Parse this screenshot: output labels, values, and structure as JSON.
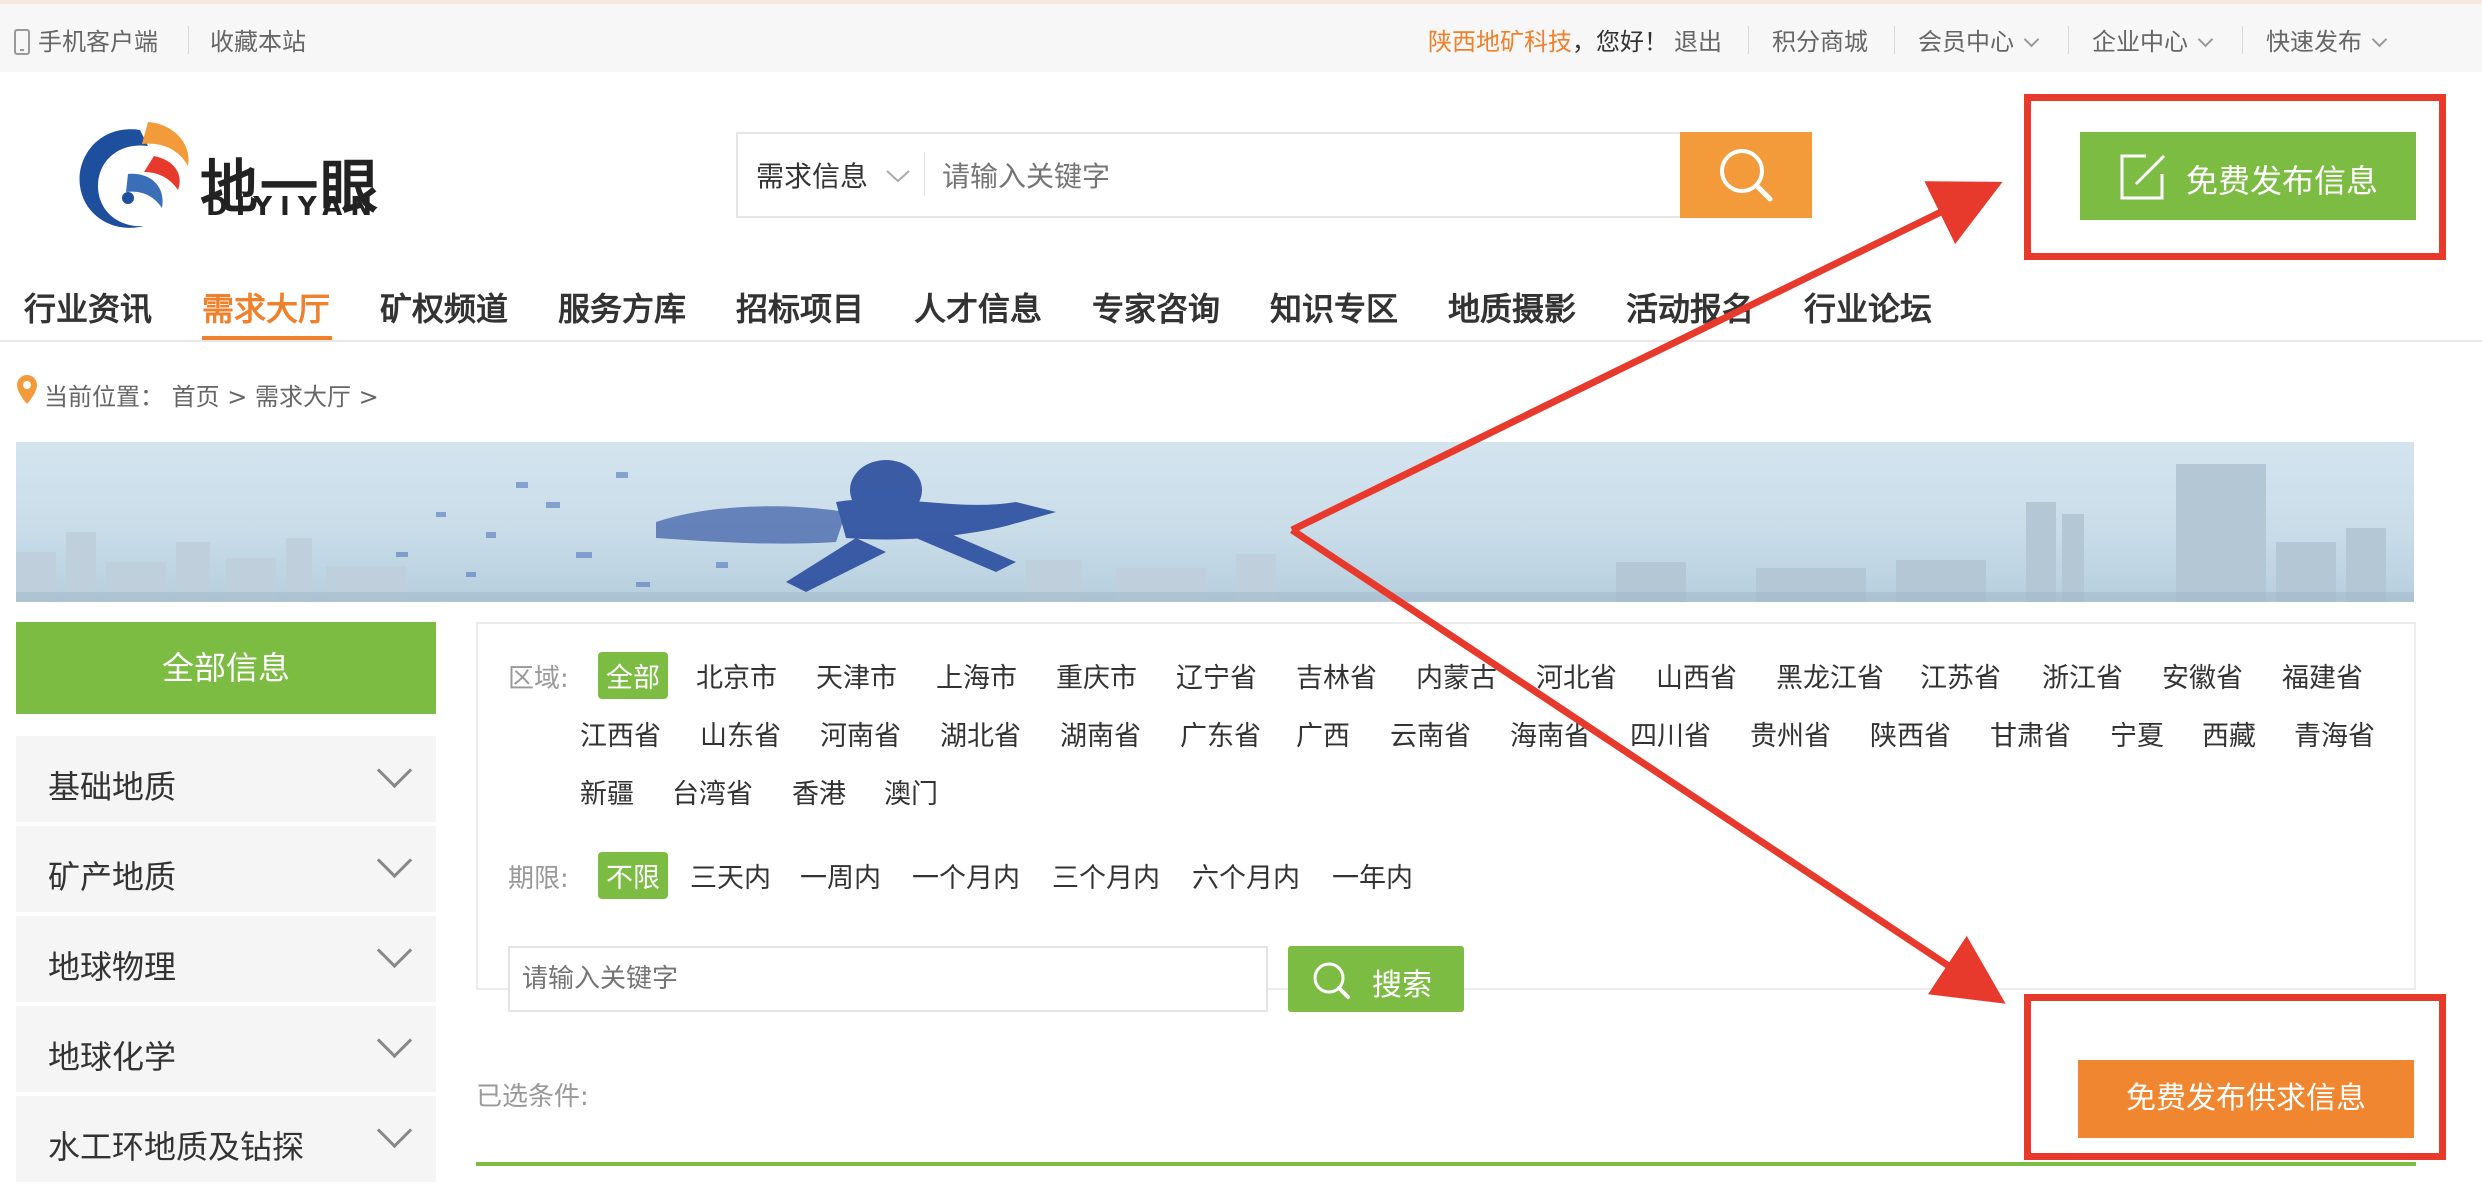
{
  "topbar": {
    "mobile_client": "手机客户端",
    "bookmark": "收藏本站",
    "company": "陕西地矿科技",
    "greeting": "，您好！",
    "logout": "退出",
    "points_mall": "积分商城",
    "member_center": "会员中心",
    "enterprise_center": "企业中心",
    "quick_publish": "快速发布"
  },
  "logo": {
    "name": "地一眼",
    "sub": "DIYIYAN"
  },
  "search": {
    "type": "需求信息",
    "placeholder": "请输入关键字"
  },
  "publish_button": "免费发布信息",
  "nav": [
    "行业资讯",
    "需求大厅",
    "矿权频道",
    "服务方库",
    "招标项目",
    "人才信息",
    "专家咨询",
    "知识专区",
    "地质摄影",
    "活动报名",
    "行业论坛"
  ],
  "breadcrumb": {
    "prefix": "当前位置：",
    "home": "首页",
    "sep": ">",
    "current": "需求大厅"
  },
  "sidebar": {
    "all": "全部信息",
    "items": [
      "基础地质",
      "矿产地质",
      "地球物理",
      "地球化学",
      "水工环地质及钻探"
    ]
  },
  "filters": {
    "region_label": "区域:",
    "regions_row1": [
      "全部",
      "北京市",
      "天津市",
      "上海市",
      "重庆市",
      "辽宁省",
      "吉林省",
      "内蒙古",
      "河北省",
      "山西省",
      "黑龙江省",
      "江苏省",
      "浙江省",
      "安徽省",
      "福建省"
    ],
    "regions_row2": [
      "江西省",
      "山东省",
      "河南省",
      "湖北省",
      "湖南省",
      "广东省",
      "广西",
      "云南省",
      "海南省",
      "四川省",
      "贵州省",
      "陕西省",
      "甘肃省",
      "宁夏",
      "西藏",
      "青海省"
    ],
    "regions_row3": [
      "新疆",
      "台湾省",
      "香港",
      "澳门"
    ],
    "period_label": "期限:",
    "periods": [
      "不限",
      "三天内",
      "一周内",
      "一个月内",
      "三个月内",
      "六个月内",
      "一年内"
    ],
    "keyword_placeholder": "请输入关键字",
    "search_button": "搜索"
  },
  "selected_conditions": "已选条件:",
  "supply_button": "免费发布供求信息",
  "colors": {
    "green": "#7cbc43",
    "orange": "#f39a3b",
    "accent_text": "#f0802a",
    "annotation": "#e83a2c"
  }
}
